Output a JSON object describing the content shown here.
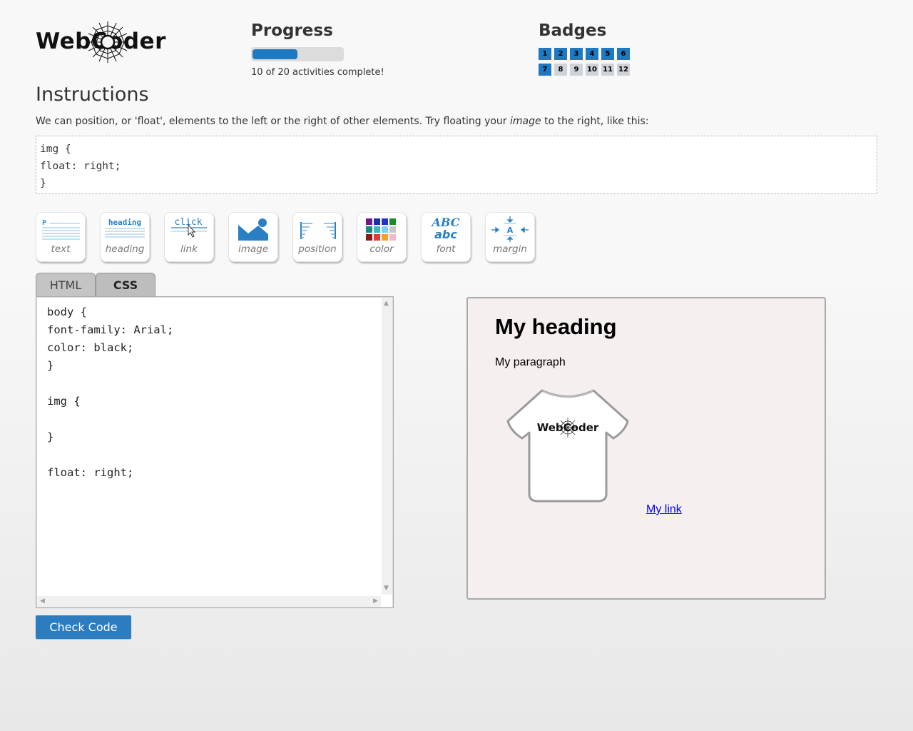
{
  "header": {
    "logo_text": "WebCoder",
    "progress": {
      "title": "Progress",
      "completed": 10,
      "total": 20,
      "text": "10 of 20 activities complete!"
    },
    "badges": {
      "title": "Badges",
      "items": [
        {
          "label": "1",
          "earned": true
        },
        {
          "label": "2",
          "earned": true
        },
        {
          "label": "3",
          "earned": true
        },
        {
          "label": "4",
          "earned": true
        },
        {
          "label": "5",
          "earned": true
        },
        {
          "label": "6",
          "earned": true
        },
        {
          "label": "7",
          "earned": true
        },
        {
          "label": "8",
          "earned": false
        },
        {
          "label": "9",
          "earned": false
        },
        {
          "label": "10",
          "earned": false
        },
        {
          "label": "11",
          "earned": false
        },
        {
          "label": "12",
          "earned": false
        }
      ]
    }
  },
  "instructions": {
    "title": "Instructions",
    "text_before": "We can position, or 'float', elements to the left or the right of other elements. Try floating your ",
    "text_emphasis": "image",
    "text_after": " to the right, like this:",
    "code_example": "img {\nfloat: right;\n}"
  },
  "tools": [
    {
      "label": "text",
      "icon": "text-icon"
    },
    {
      "label": "heading",
      "icon": "heading-icon",
      "icon_text": "heading"
    },
    {
      "label": "link",
      "icon": "link-icon",
      "icon_text": "click"
    },
    {
      "label": "image",
      "icon": "image-icon"
    },
    {
      "label": "position",
      "icon": "position-icon"
    },
    {
      "label": "color",
      "icon": "color-icon"
    },
    {
      "label": "font",
      "icon": "font-icon",
      "icon_text_upper": "ABC",
      "icon_text_lower": "abc"
    },
    {
      "label": "margin",
      "icon": "margin-icon",
      "icon_text": "A"
    }
  ],
  "tabs": {
    "html_label": "HTML",
    "css_label": "CSS",
    "active": "CSS"
  },
  "editor": {
    "code": "body {\nfont-family: Arial;\ncolor: black;\n}\n\nimg {\n\n}\n\nfloat: right;"
  },
  "preview": {
    "heading": "My heading",
    "paragraph": "My paragraph",
    "image_text": "WebCoder",
    "link_text": "My link"
  },
  "actions": {
    "check_code_label": "Check Code"
  },
  "colors": {
    "accent": "#1f79c0",
    "button": "#2c7dc0",
    "badge_locked": "#cfd3d8",
    "preview_bg": "#f5efef"
  }
}
